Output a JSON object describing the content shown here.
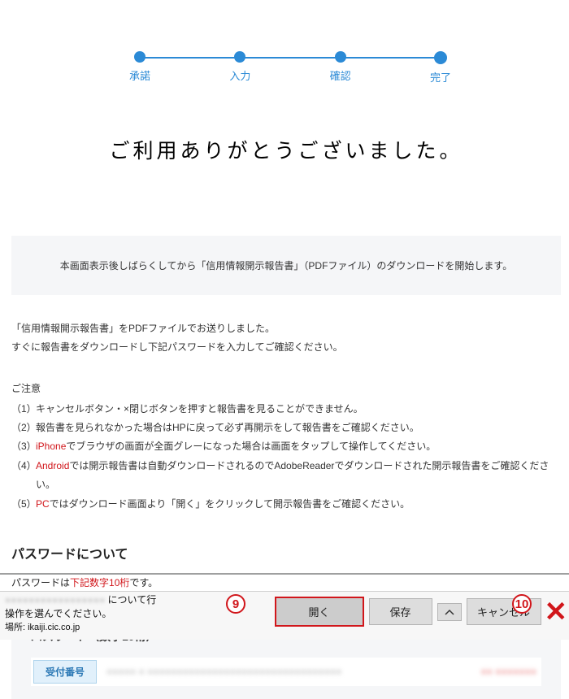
{
  "stepper": [
    "承諾",
    "入力",
    "確認",
    "完了"
  ],
  "title": "ご利用ありがとうございました。",
  "infoBox": "本画面表示後しばらくしてから「信用情報開示報告書」（PDFファイル）のダウンロードを開始します。",
  "sent": [
    "「信用情報開示報告書」をPDFファイルでお送りしました。",
    "すぐに報告書をダウンロードし下記パスワードを入力してご確認ください。"
  ],
  "cautionHead": "ご注意",
  "cautions": [
    {
      "n": "（1）",
      "pre": "",
      "red": "",
      "post": "キャンセルボタン・×閉じボタンを押すと報告書を見ることができません。"
    },
    {
      "n": "（2）",
      "pre": "",
      "red": "",
      "post": "報告書を見られなかった場合はHPに戻って必ず再開示をして報告書をご確認ください。"
    },
    {
      "n": "（3）",
      "pre": "",
      "red": "iPhone",
      "post": "でブラウザの画面が全面グレーになった場合は画面をタップして操作してください。"
    },
    {
      "n": "（4）",
      "pre": "",
      "red": "Android",
      "post": "では開示報告書は自動ダウンロードされるのでAdobeReaderでダウンロードされた開示報告書をご確認ください。"
    },
    {
      "n": "（5）",
      "pre": "",
      "red": "PC",
      "post": "ではダウンロード画面より「開く」をクリックして開示報告書をご確認ください。"
    }
  ],
  "pwdTitle": "パスワードについて",
  "pwdDesc": {
    "pre": "パスワードは",
    "red": "下記数字10桁",
    "post": "です。"
  },
  "pwdPanelTitle": "パスワード（数字10桁）",
  "receiptLabel": "受付番号",
  "receiptMock": "●●●●●  ●     ●●●●●●●●●●●●●●●●●●●●●●●●●●●●●●●●●",
  "receiptMockRed": "●●  ●●●●●●●",
  "download": {
    "fileLinePrefix": "●●●●●●●●●●●●●●●●●",
    "fileLineSuffix": " について行",
    "line2": "操作を選んでください。",
    "line3": "場所: ikaiji.cic.co.jp",
    "open": "開く",
    "save": "保存",
    "cancel": "キャンセル",
    "close": "✕"
  },
  "annotations": {
    "nine": "9",
    "ten": "10"
  }
}
